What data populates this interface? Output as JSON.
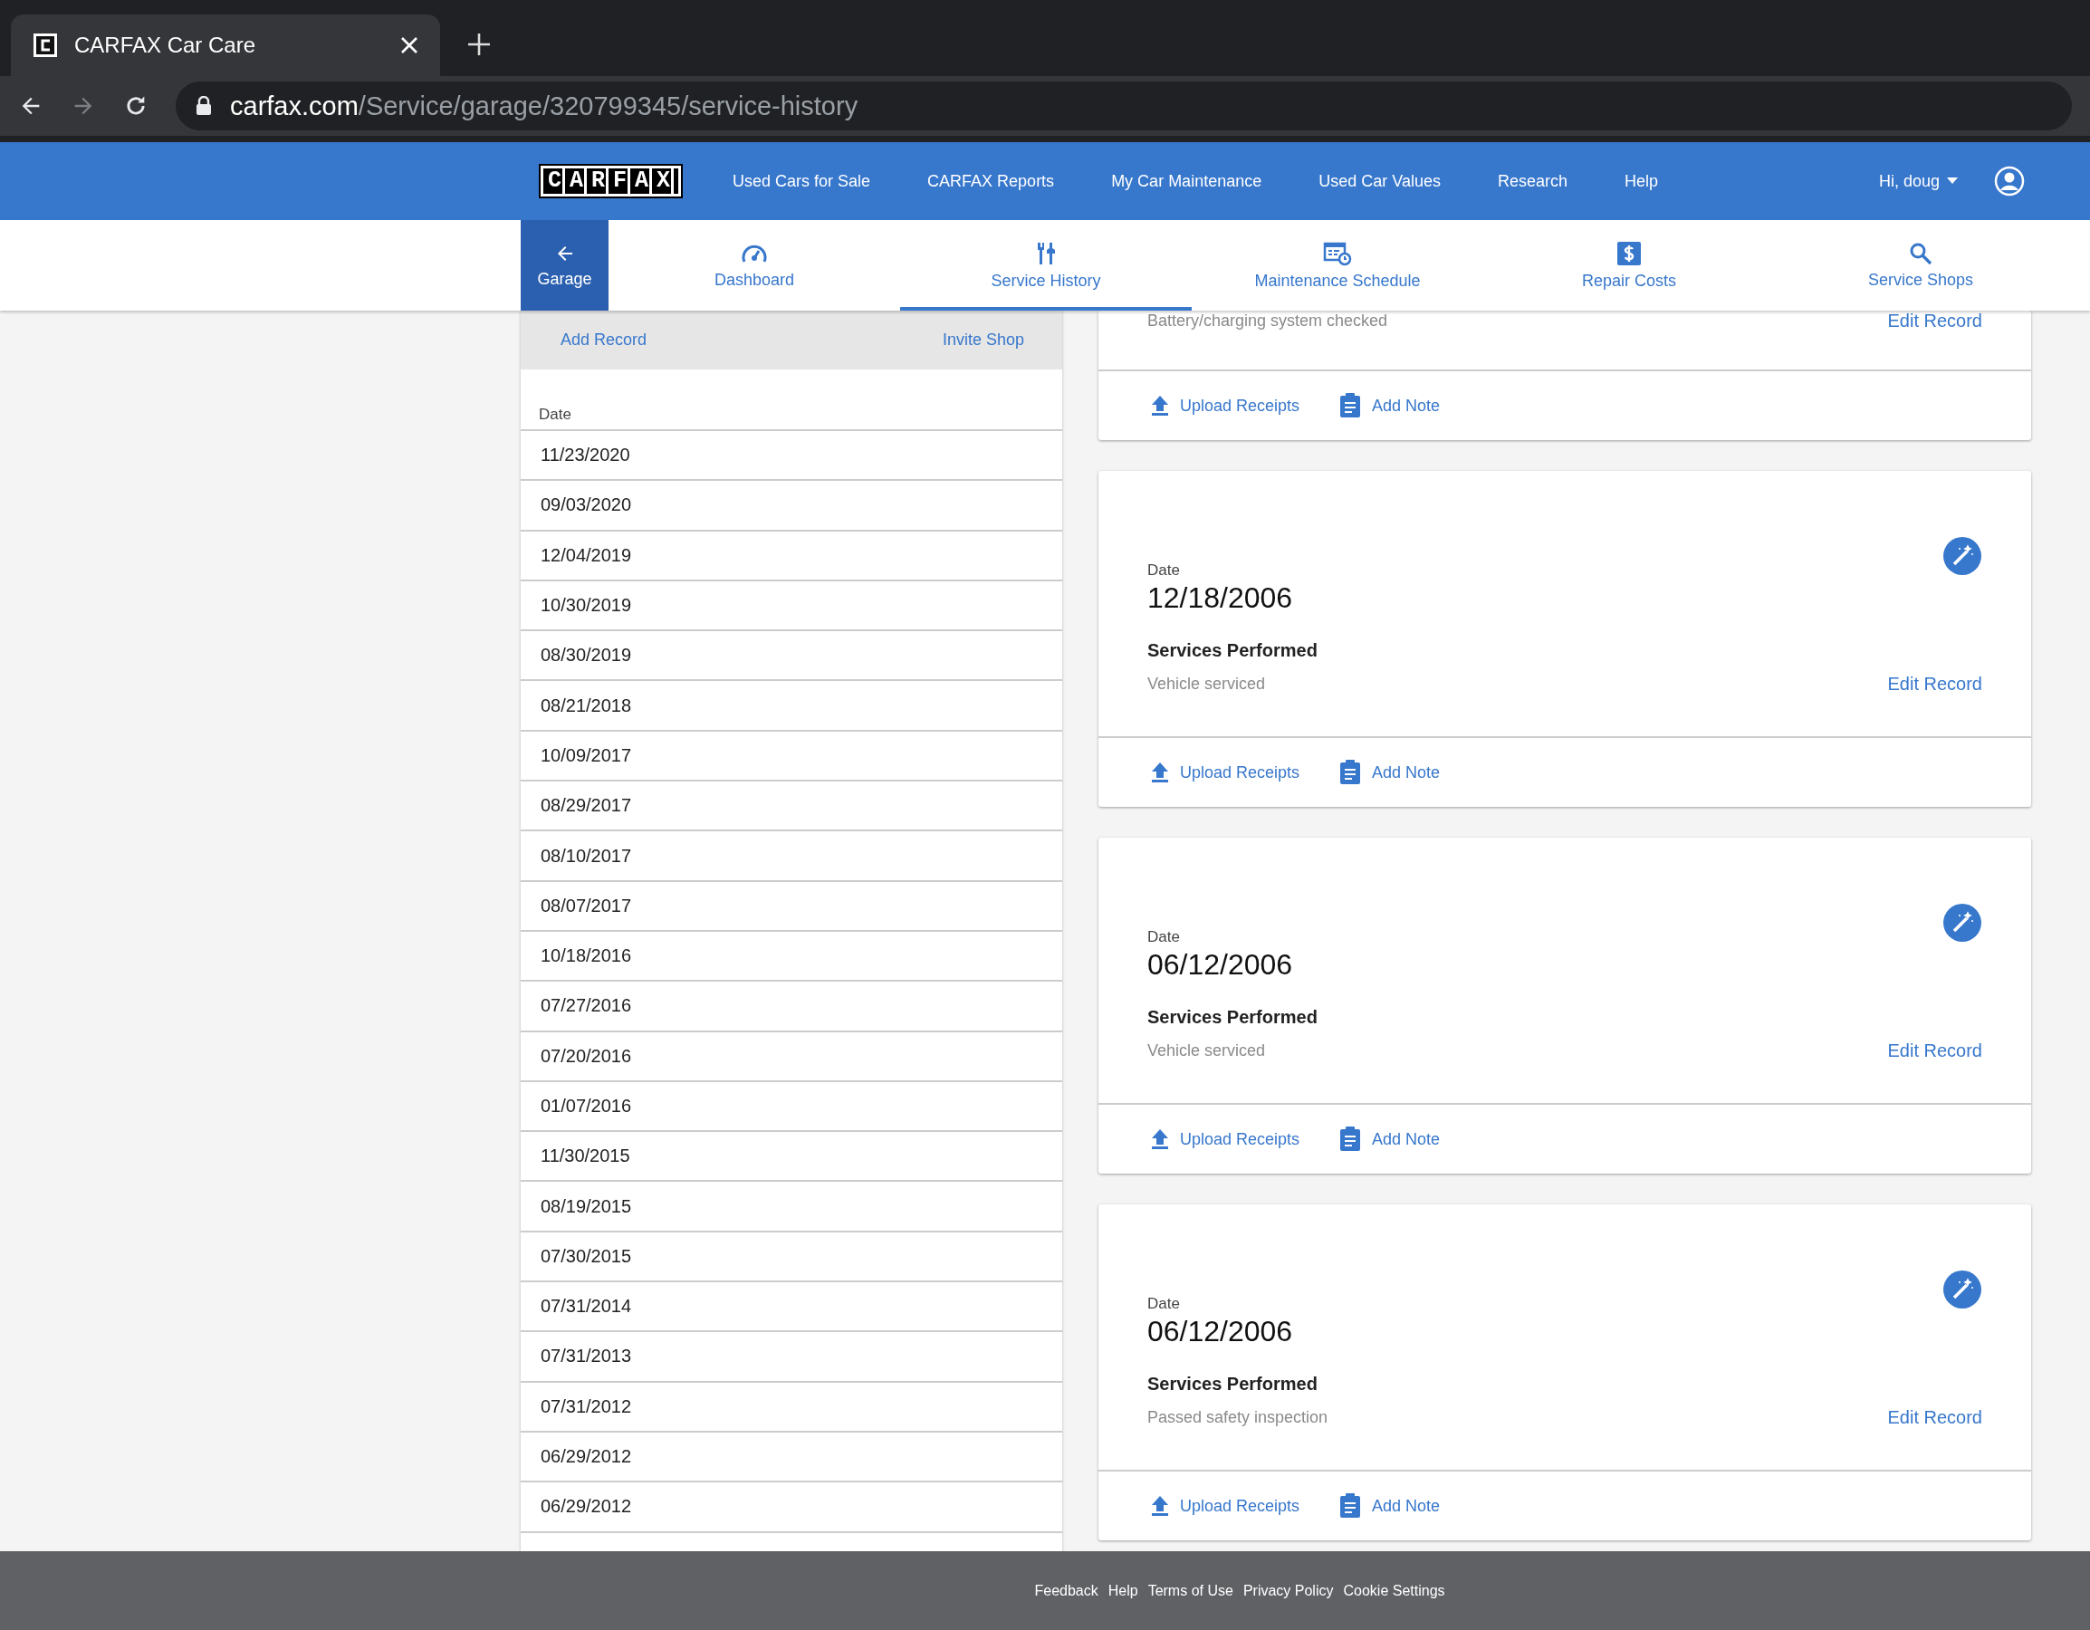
{
  "browser": {
    "tab_title": "CARFAX Car Care",
    "url_host": "carfax.com",
    "url_path": "/Service/garage/320799345/service-history"
  },
  "header": {
    "logo": "CARFAX",
    "nav": [
      "Used Cars for Sale",
      "CARFAX Reports",
      "My Car Maintenance",
      "Used Car Values",
      "Research",
      "Help"
    ],
    "user": "Hi, doug"
  },
  "subnav": [
    {
      "kind": "back",
      "label": "Garage",
      "selected": false
    },
    {
      "kind": "dashboard",
      "label": "Dashboard",
      "selected": false
    },
    {
      "kind": "tools",
      "label": "Service History",
      "selected": true
    },
    {
      "kind": "schedule",
      "label": "Maintenance Schedule",
      "selected": false
    },
    {
      "kind": "costs",
      "label": "Repair Costs",
      "selected": false
    },
    {
      "kind": "search",
      "label": "Service Shops",
      "selected": false
    }
  ],
  "history": {
    "actions": [
      "Add Record",
      "Invite Shop"
    ],
    "column": "Date",
    "dates": [
      "11/23/2020",
      "09/03/2020",
      "12/04/2019",
      "10/30/2019",
      "08/30/2019",
      "08/21/2018",
      "10/09/2017",
      "08/29/2017",
      "08/10/2017",
      "08/07/2017",
      "10/18/2016",
      "07/27/2016",
      "07/20/2016",
      "01/07/2016",
      "11/30/2015",
      "08/19/2015",
      "07/30/2015",
      "07/31/2014",
      "07/31/2013",
      "07/31/2012",
      "06/29/2012",
      "06/29/2012"
    ]
  },
  "records": [
    {
      "description": "Battery/charging system checked",
      "edit": "Edit Record",
      "actions": [
        "Upload Receipts",
        "Add Note"
      ]
    },
    {
      "date_label": "Date",
      "date": "12/18/2006",
      "services_label": "Services Performed",
      "description": "Vehicle serviced",
      "edit": "Edit Record",
      "actions": [
        "Upload Receipts",
        "Add Note"
      ]
    },
    {
      "date_label": "Date",
      "date": "06/12/2006",
      "services_label": "Services Performed",
      "description": "Vehicle serviced",
      "edit": "Edit Record",
      "actions": [
        "Upload Receipts",
        "Add Note"
      ]
    },
    {
      "date_label": "Date",
      "date": "06/12/2006",
      "services_label": "Services Performed",
      "description": "Passed safety inspection",
      "edit": "Edit Record",
      "actions": [
        "Upload Receipts",
        "Add Note"
      ]
    }
  ],
  "footer": [
    "Feedback",
    "Help",
    "Terms of Use",
    "Privacy Policy",
    "Cookie Settings"
  ]
}
